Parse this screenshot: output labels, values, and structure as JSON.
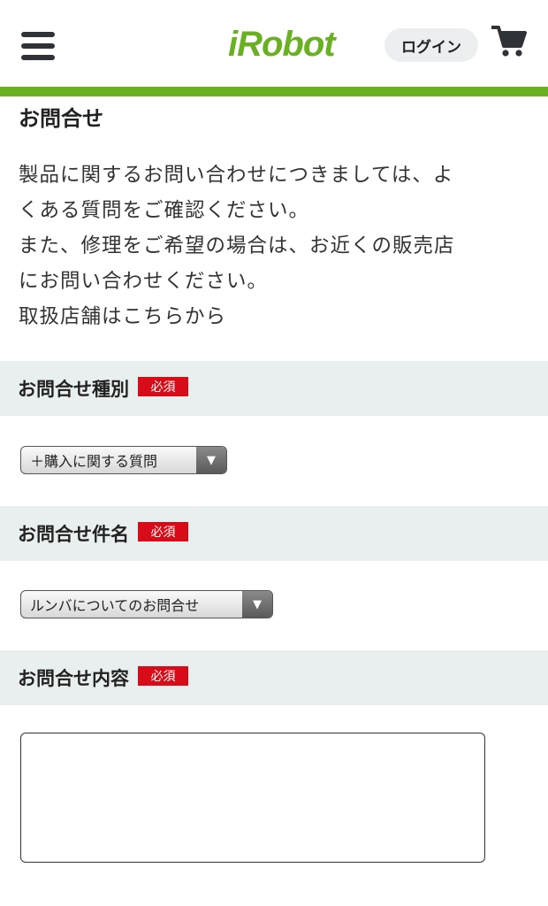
{
  "header": {
    "logo_text": "iRobot",
    "login_label": "ログイン",
    "brand_color": "#6ab023"
  },
  "page": {
    "title": "お問合せ",
    "intro_lines": [
      "製品に関するお問い合わせにつきましては、よ",
      "くある質問をご確認ください。",
      "また、修理をご希望の場合は、お近くの販売店",
      "にお問い合わせください。",
      "取扱店舗はこちらから"
    ]
  },
  "form": {
    "required_label": "必須",
    "required_color": "#d80c18",
    "type": {
      "label": "お問合せ種別",
      "selected": "＋購入に関する質問"
    },
    "subject": {
      "label": "お問合せ件名",
      "selected": "ルンバについてのお問合せ"
    },
    "content": {
      "label": "お問合せ内容",
      "value": ""
    }
  },
  "icons": {
    "menu": "hamburger-menu-icon",
    "cart": "cart-icon",
    "select_arrow": "triangle-down-icon"
  }
}
